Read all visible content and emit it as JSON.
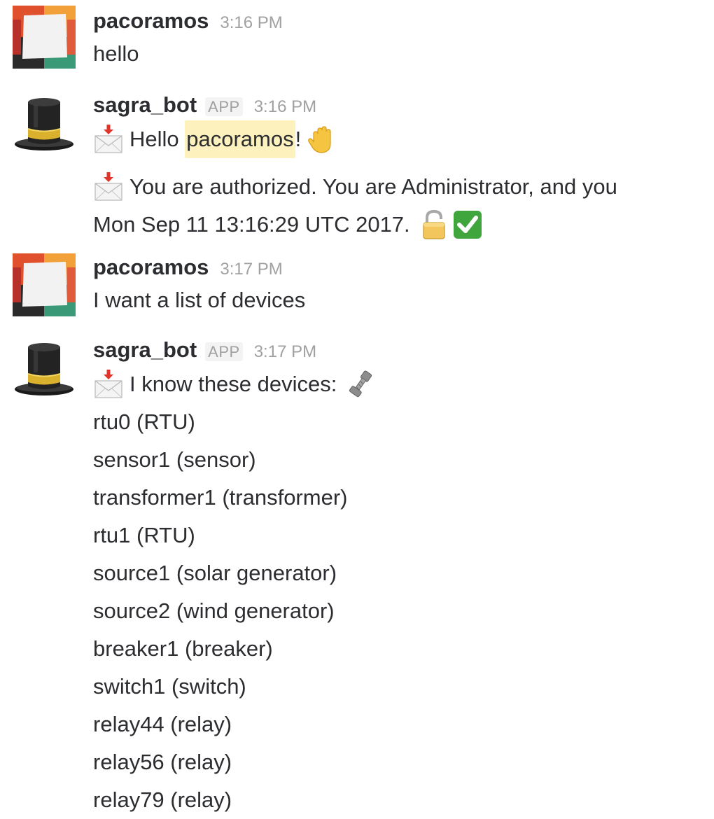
{
  "messages": [
    {
      "author": "pacoramos",
      "time": "3:16 PM",
      "lines": [
        "hello"
      ]
    },
    {
      "author": "sagra_bot",
      "badge": "APP",
      "time": "3:16 PM",
      "greeting": {
        "prefix": "Hello ",
        "mention": "pacoramos",
        "suffix": "!"
      },
      "auth_line_1": "You are authorized. You are Administrator, and you",
      "auth_line_2": "Mon Sep 11 13:16:29 UTC 2017."
    },
    {
      "author": "pacoramos",
      "time": "3:17 PM",
      "lines": [
        "I want a list of devices"
      ]
    },
    {
      "author": "sagra_bot",
      "badge": "APP",
      "time": "3:17 PM",
      "intro": "I know these devices:",
      "devices": [
        "rtu0 (RTU)",
        "sensor1 (sensor)",
        "transformer1 (transformer)",
        "rtu1 (RTU)",
        "source1 (solar generator)",
        "source2 (wind generator)",
        "breaker1 (breaker)",
        "switch1 (switch)",
        "relay44 (relay)",
        "relay56 (relay)",
        "relay79 (relay)"
      ]
    }
  ],
  "icons": {
    "user_avatar": "pacoramos-avatar",
    "bot_avatar": "top-hat-icon",
    "incoming_envelope": "incoming-envelope-icon",
    "raised_hand": "raised-hand-icon",
    "unlock": "open-lock-icon",
    "check": "white-check-mark-icon",
    "nut_and_bolt": "nut-and-bolt-icon"
  },
  "colors": {
    "author": "#2c2d30",
    "timestamp": "#a0a0a2",
    "mention_highlight": "#fdf1bd",
    "check_green": "#3fa53c"
  }
}
